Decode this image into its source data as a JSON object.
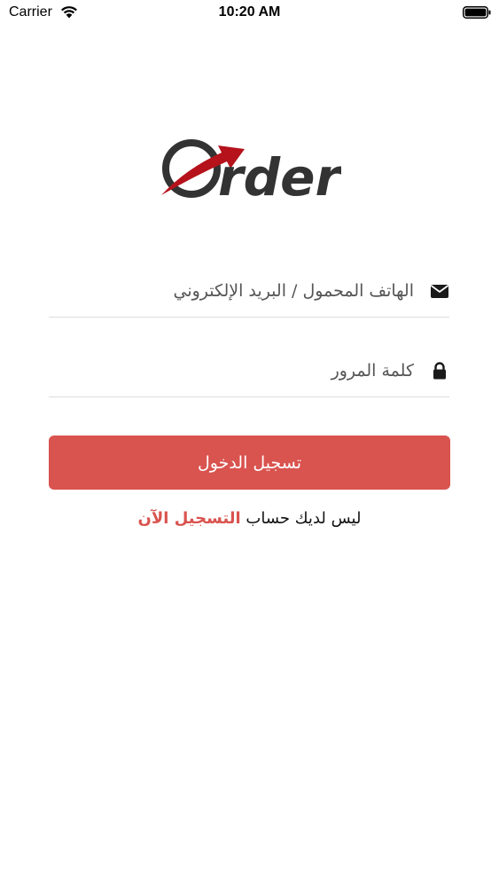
{
  "status_bar": {
    "carrier": "Carrier",
    "time": "10:20 AM"
  },
  "logo": {
    "text": "rder",
    "accent_color": "#b5121b",
    "text_color": "#333333"
  },
  "login_form": {
    "email_placeholder": "الهاتف المحمول / البريد الإلكتروني",
    "password_placeholder": "كلمة المرور",
    "email_icon": "envelope-icon",
    "password_icon": "lock-icon",
    "submit_label": "تسجيل الدخول"
  },
  "register": {
    "prompt": "ليس لديك حساب",
    "link_label": "التسجيل الآن"
  },
  "colors": {
    "primary": "#d9534f",
    "divider": "#dcdcdc"
  }
}
